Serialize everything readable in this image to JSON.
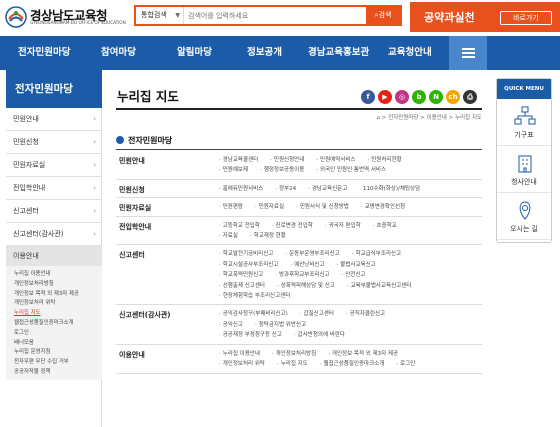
{
  "header": {
    "logo_title": "경상남도교육청",
    "logo_sub": "GYEONGSANGNAM-DO OFFICE OF EDUCATION",
    "search_scope": "통합검색",
    "search_placeholder": "검색어를 입력하세요",
    "search_button": "검색",
    "promo_text": "공약과실천",
    "promo_button": "바로가기"
  },
  "gnb": [
    "전자민원마당",
    "참여마당",
    "알림마당",
    "정보공개",
    "경남교육홍보관",
    "교육청안내"
  ],
  "lnb": {
    "title": "전자민원마당",
    "items": [
      "민원안내",
      "민원신청",
      "민원자료실",
      "전입학안내",
      "신고센터",
      "신고센터(감사관)"
    ],
    "sub_title": "이용안내",
    "sub_items": [
      "누리집 이용안내",
      "개인정보처리방침",
      "개인정보 목적 외 제3자 제공",
      "개인정보처리 위탁",
      "누리집 지도",
      "웹접근성품질인증마크소개",
      "로그인",
      "배너모음",
      "누리집 운영지침",
      "전자우편 무단 수집 거부",
      "공공저작물 정책"
    ],
    "sub_active": 4
  },
  "main": {
    "title": "누리집 지도",
    "breadcrumb": "⌂ > 전자민원마당 > 이용안내 > 누리집 지도",
    "section_title": "전자민원마당",
    "sns": [
      {
        "label": "f",
        "color": "#3b5998"
      },
      {
        "label": "▶",
        "color": "#e62117"
      },
      {
        "label": "◎",
        "color": "#c13584"
      },
      {
        "label": "b",
        "color": "#2db400"
      },
      {
        "label": "N",
        "color": "#2db400"
      },
      {
        "label": "ch",
        "color": "#f5a500"
      },
      {
        "label": "⎙",
        "color": "#333333"
      }
    ],
    "sitemap": [
      {
        "name": "민원안내",
        "rows": [
          [
            "경남교육콜센터",
            "민원신청안내",
            "민원예약서비스",
            "민원처리현황"
          ],
          [
            "민원예보제",
            "행정정보공동이용",
            "외국인 민원인 통번역 서비스"
          ]
        ]
      },
      {
        "name": "민원신청",
        "rows": [
          [
            "홈에듀민원서비스",
            "정부24",
            "경남교육신문고",
            "110수화(화상)/채팅상담"
          ]
        ]
      },
      {
        "name": "민원자료실",
        "rows": [
          [
            "민원편람",
            "민원자료실",
            "민원서식 및 신청방법",
            "교명변경확인신청"
          ]
        ]
      },
      {
        "name": "전입학안내",
        "rows": [
          [
            "고등학교 전입학",
            "진로변경 전입학",
            "귀국자 편입학",
            "초중학교"
          ],
          [
            "자료실",
            "학교재정 현황"
          ]
        ]
      },
      {
        "name": "신고센터",
        "rows": [
          [
            "학교발전기금비리신고",
            "운동부운영부조리신고",
            "학교급식부조리신고"
          ],
          [
            "학교시설공사부조리신고",
            "예산낭비신고",
            "불법사교육신고"
          ],
          [
            "학교폭력민원신고",
            "방과후학교부조리신고",
            "안전신고"
          ],
          [
            "선행출제 신고센터",
            "성폭력피해상담 및 신고",
            "교육부불법사교육신고센터"
          ],
          [
            "현장체험학습 부조리신고센터"
          ]
        ]
      },
      {
        "name": "신고센터(감사관)",
        "rows": [
          [
            "공익감사청구(부패비리신고)",
            "갑질신고센터",
            "공직자클린신고"
          ],
          [
            "공익신고",
            "청탁금지법 위반신고"
          ],
          [
            "공공재정 부정청구등 신고",
            "갑사반청의에 바란다"
          ]
        ]
      },
      {
        "name": "이용안내",
        "rows": [
          [
            "누리집 이용안내",
            "개인정보처리방침",
            "개인정보 목적 외 제3자 제공"
          ],
          [
            "개인정보처리 위탁",
            "누리집 지도",
            "웹접근성품질인증마크소개",
            "로그인"
          ]
        ]
      }
    ]
  },
  "quick": {
    "title": "QUICK MENU",
    "items": [
      "기구표",
      "청사안내",
      "오시는 길"
    ]
  }
}
